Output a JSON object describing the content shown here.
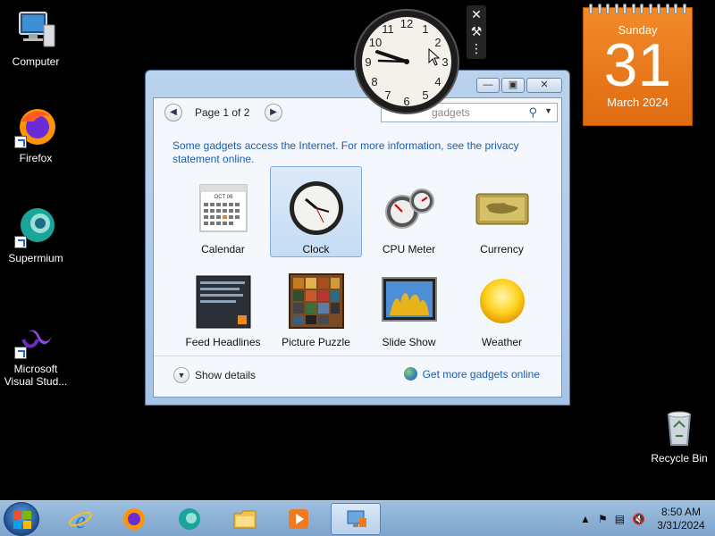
{
  "desktop": {
    "icons": [
      {
        "label": "Computer"
      },
      {
        "label": "Firefox"
      },
      {
        "label": "Supermium"
      },
      {
        "label": "Microsoft Visual Stud..."
      },
      {
        "label": "Recycle Bin"
      }
    ]
  },
  "calendar_gadget": {
    "weekday": "Sunday",
    "day": "31",
    "month_year": "March 2024"
  },
  "gadgets_window": {
    "page_label": "Page 1 of 2",
    "search_placeholder": "Search gadgets",
    "search_visible_text": "gadgets",
    "info_text": "Some gadgets access the Internet.  For more information, see the privacy statement online.",
    "gadgets": [
      {
        "label": "Calendar"
      },
      {
        "label": "Clock",
        "selected": true
      },
      {
        "label": "CPU Meter"
      },
      {
        "label": "Currency"
      },
      {
        "label": "Feed Headlines"
      },
      {
        "label": "Picture Puzzle"
      },
      {
        "label": "Slide Show"
      },
      {
        "label": "Weather"
      }
    ],
    "calendar_thumb_month": "OCT 06",
    "show_details": "Show details",
    "get_more": "Get more gadgets online"
  },
  "taskbar": {
    "time": "8:50 AM",
    "date": "3/31/2024"
  },
  "colors": {
    "accent": "#1a5fb4",
    "calendar_orange": "#e97a1e",
    "selection": "#c4dcf3"
  }
}
